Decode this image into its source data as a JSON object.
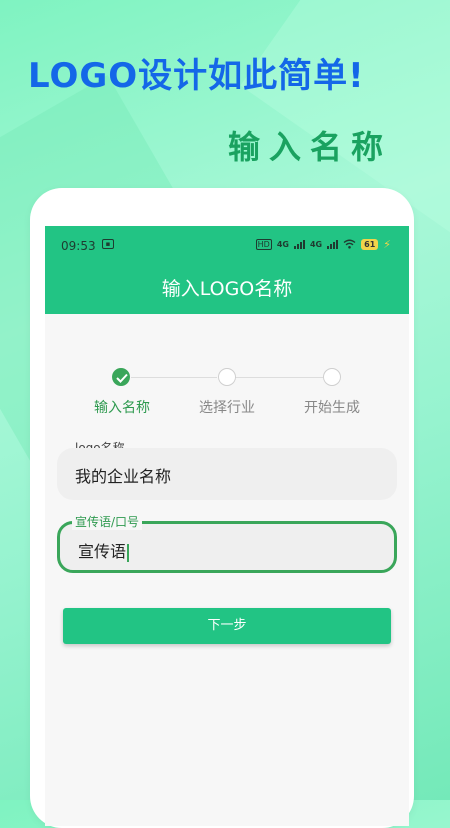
{
  "promo": {
    "headline": "LOGO设计如此简单!",
    "subhead": "输入名称"
  },
  "status_bar": {
    "time": "09:53",
    "hd": "HD",
    "net1": "4G",
    "net2": "4G",
    "battery": "61"
  },
  "app": {
    "title": "输入LOGO名称"
  },
  "steps": [
    {
      "label": "输入名称",
      "state": "done"
    },
    {
      "label": "选择行业",
      "state": "pending"
    },
    {
      "label": "开始生成",
      "state": "pending"
    }
  ],
  "form": {
    "name_label": "logo名称",
    "name_value": "我的企业名称",
    "slogan_label": "宣传语/口号",
    "slogan_value": "宣传语",
    "next_button": "下一步"
  },
  "colors": {
    "accent": "#22c484",
    "step_done": "#3aa65a",
    "headline": "#1467e8",
    "subhead": "#1aa260"
  }
}
